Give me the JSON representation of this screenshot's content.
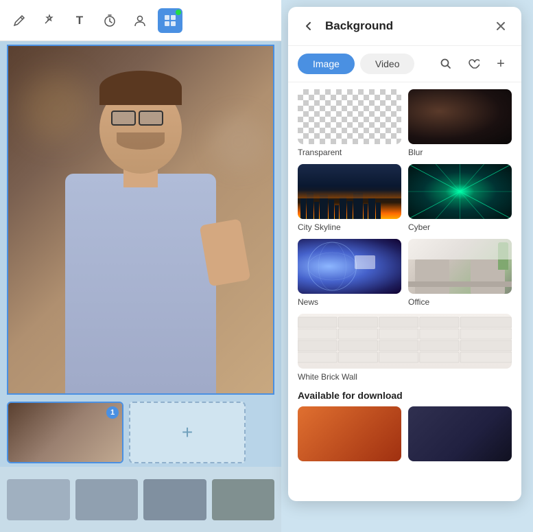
{
  "toolbar": {
    "tools": [
      {
        "name": "pen-tool",
        "icon": "✏️",
        "active": false
      },
      {
        "name": "magic-tool",
        "icon": "✨",
        "active": false
      },
      {
        "name": "text-tool",
        "icon": "T",
        "active": false
      },
      {
        "name": "timer-tool",
        "icon": "⏱",
        "active": false
      },
      {
        "name": "person-tool",
        "icon": "👤",
        "active": false
      },
      {
        "name": "grid-tool",
        "icon": "⬛",
        "active": true
      }
    ]
  },
  "panel": {
    "title": "Background",
    "back_label": "‹",
    "close_label": "×",
    "tabs": [
      {
        "label": "Image",
        "active": true
      },
      {
        "label": "Video",
        "active": false
      }
    ],
    "icons": [
      {
        "name": "search-icon",
        "symbol": "🔍"
      },
      {
        "name": "heart-icon",
        "symbol": "♡"
      },
      {
        "name": "plus-icon",
        "symbol": "+"
      }
    ],
    "items": [
      {
        "label": "Transparent",
        "bg_class": "bg-transparent"
      },
      {
        "label": "Blur",
        "bg_class": "bg-blur"
      },
      {
        "label": "City Skyline",
        "bg_class": "bg-city"
      },
      {
        "label": "Cyber",
        "bg_class": "bg-cyber"
      },
      {
        "label": "News",
        "bg_class": "bg-news"
      },
      {
        "label": "Office",
        "bg_class": "bg-office"
      },
      {
        "label": "White Brick Wall",
        "bg_class": "bg-brick",
        "full_width": true
      }
    ],
    "available_section_label": "Available for download",
    "available_items": [
      {
        "bg_class": "bg-download1"
      },
      {
        "bg_class": "bg-download2"
      }
    ]
  },
  "thumbnail_strip": {
    "badge": "1",
    "add_label": "+"
  }
}
